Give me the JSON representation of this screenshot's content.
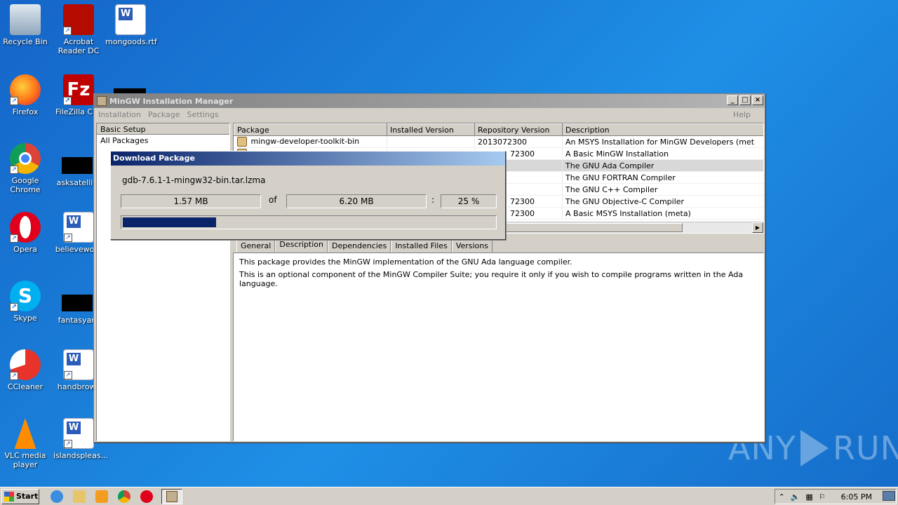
{
  "desktop": {
    "icons": [
      {
        "label": "Recycle Bin"
      },
      {
        "label": "Acrobat Reader DC"
      },
      {
        "label": "mongoods.rtf"
      },
      {
        "label": "Firefox"
      },
      {
        "label": "FileZilla Clie"
      },
      {
        "label": "Google Chrome"
      },
      {
        "label": "asksatellite"
      },
      {
        "label": "Opera"
      },
      {
        "label": "believework"
      },
      {
        "label": "Skype"
      },
      {
        "label": "fantasyare"
      },
      {
        "label": "CCleaner"
      },
      {
        "label": "handbrows"
      },
      {
        "label": "VLC media player"
      },
      {
        "label": "islandspleas..."
      }
    ]
  },
  "window": {
    "title": "MinGW Installation Manager",
    "menu": {
      "installation": "Installation",
      "package": "Package",
      "settings": "Settings",
      "help": "Help"
    },
    "minimize": "_",
    "maximize": "□",
    "close": "×"
  },
  "left_pane": {
    "header": "Basic Setup",
    "items": [
      "All Packages"
    ]
  },
  "package_table": {
    "columns": [
      "Package",
      "Installed Version",
      "Repository Version",
      "Description"
    ],
    "rows": [
      {
        "package": "mingw-developer-toolkit-bin",
        "installed": "",
        "repository": "2013072300",
        "description": "An MSYS Installation for MinGW Developers (met"
      },
      {
        "package": "",
        "installed": "",
        "repository": "72300",
        "description": "A Basic MinGW Installation"
      },
      {
        "package": "",
        "installed": "",
        "repository": "",
        "description": "The GNU Ada Compiler"
      },
      {
        "package": "",
        "installed": "",
        "repository": "",
        "description": "The GNU FORTRAN Compiler"
      },
      {
        "package": "",
        "installed": "",
        "repository": "",
        "description": "The GNU C++ Compiler"
      },
      {
        "package": "",
        "installed": "",
        "repository": "72300",
        "description": "The GNU Objective-C Compiler"
      },
      {
        "package": "",
        "installed": "",
        "repository": "72300",
        "description": "A Basic MSYS Installation (meta)"
      }
    ]
  },
  "tabs": [
    "General",
    "Description",
    "Dependencies",
    "Installed Files",
    "Versions"
  ],
  "description": {
    "line1": "This package provides the MinGW implementation of the GNU Ada language compiler.",
    "line2": "This is an optional component of the MinGW Compiler Suite; you require it only if you wish to compile programs written in the Ada language."
  },
  "download_dialog": {
    "title": "Download Package",
    "filename": "gdb-7.6.1-1-mingw32-bin.tar.lzma",
    "downloaded": "1.57 MB",
    "of_label": "of",
    "total": "6.20 MB",
    "colon": ":",
    "percent_text": "25 %",
    "progress_fraction": 0.25
  },
  "taskbar": {
    "start": "Start",
    "clock": "6:05 PM"
  },
  "watermark": {
    "text_left": "ANY",
    "text_right": "RUN"
  },
  "colors": {
    "desktop": "#1a7fd8",
    "progress": "#0a246a",
    "dialog_title": "#0a246a"
  }
}
